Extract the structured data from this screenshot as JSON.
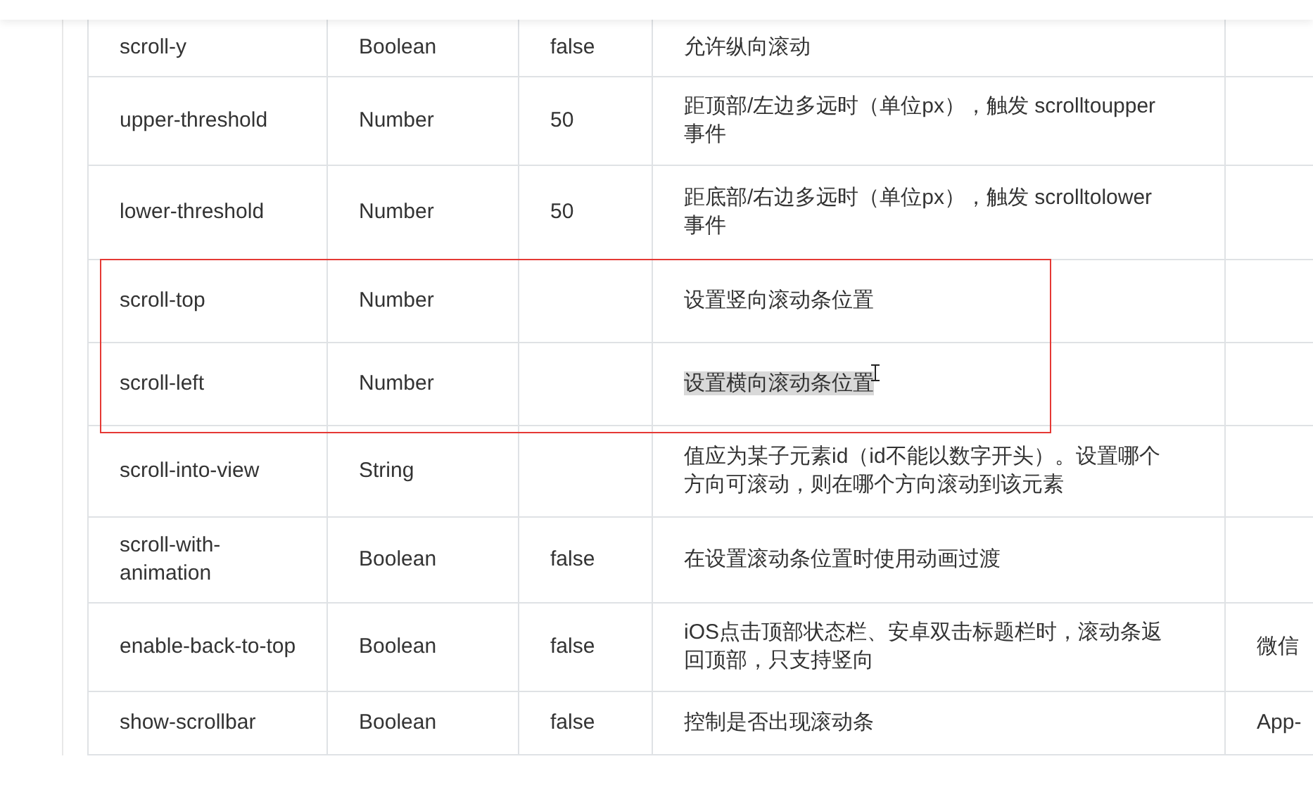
{
  "table": {
    "rows": [
      {
        "name": "scroll-y",
        "type": "Boolean",
        "default": "false",
        "description": "允许纵向滚动",
        "platform": "",
        "text_selected": false,
        "framed": false
      },
      {
        "name": "upper-threshold",
        "type": "Number",
        "default": "50",
        "description": "距顶部/左边多远时（单位px），触发 scrolltoupper 事件",
        "platform": "",
        "text_selected": false,
        "framed": false
      },
      {
        "name": "lower-threshold",
        "type": "Number",
        "default": "50",
        "description": "距底部/右边多远时（单位px），触发 scrolltolower 事件",
        "platform": "",
        "text_selected": false,
        "framed": false
      },
      {
        "name": "scroll-top",
        "type": "Number",
        "default": "",
        "description": "设置竖向滚动条位置",
        "platform": "",
        "text_selected": false,
        "framed": true
      },
      {
        "name": "scroll-left",
        "type": "Number",
        "default": "",
        "description": "设置横向滚动条位置",
        "platform": "",
        "text_selected": true,
        "framed": true
      },
      {
        "name": "scroll-into-view",
        "type": "String",
        "default": "",
        "description": "值应为某子元素id（id不能以数字开头）。设置哪个方向可滚动，则在哪个方向滚动到该元素",
        "platform": "",
        "text_selected": false,
        "framed": false
      },
      {
        "name": "scroll-with-animation",
        "type": "Boolean",
        "default": "false",
        "description": "在设置滚动条位置时使用动画过渡",
        "platform": "",
        "text_selected": false,
        "framed": false
      },
      {
        "name": "enable-back-to-top",
        "type": "Boolean",
        "default": "false",
        "description": "iOS点击顶部状态栏、安卓双击标题栏时，滚动条返回顶部，只支持竖向",
        "platform": "微信",
        "text_selected": false,
        "framed": false
      },
      {
        "name": "show-scrollbar",
        "type": "Boolean",
        "default": "false",
        "description": "控制是否出现滚动条",
        "platform": "App-",
        "text_selected": false,
        "framed": false
      }
    ]
  }
}
